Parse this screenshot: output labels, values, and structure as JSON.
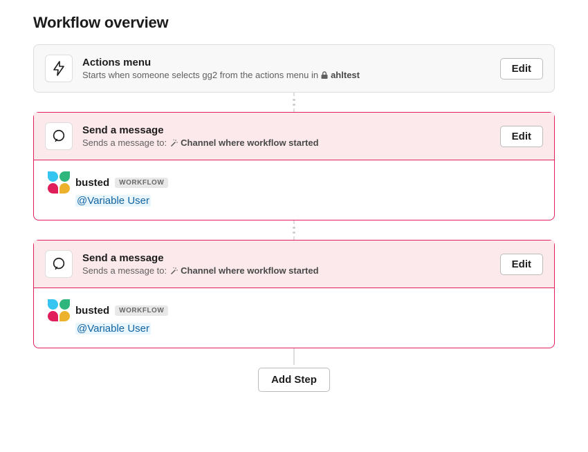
{
  "page": {
    "title": "Workflow overview",
    "add_step_label": "Add Step"
  },
  "trigger": {
    "title": "Actions menu",
    "desc_prefix": "Starts when someone selects gg2 from the actions menu in",
    "channel": "ahltest",
    "edit_label": "Edit"
  },
  "steps": [
    {
      "title": "Send a message",
      "desc_prefix": "Sends a message to:",
      "target": "Channel where workflow started",
      "edit_label": "Edit",
      "message": {
        "app_name": "busted",
        "badge": "WORKFLOW",
        "mention": "@Variable User"
      }
    },
    {
      "title": "Send a message",
      "desc_prefix": "Sends a message to:",
      "target": "Channel where workflow started",
      "edit_label": "Edit",
      "message": {
        "app_name": "busted",
        "badge": "WORKFLOW",
        "mention": "@Variable User"
      }
    }
  ]
}
